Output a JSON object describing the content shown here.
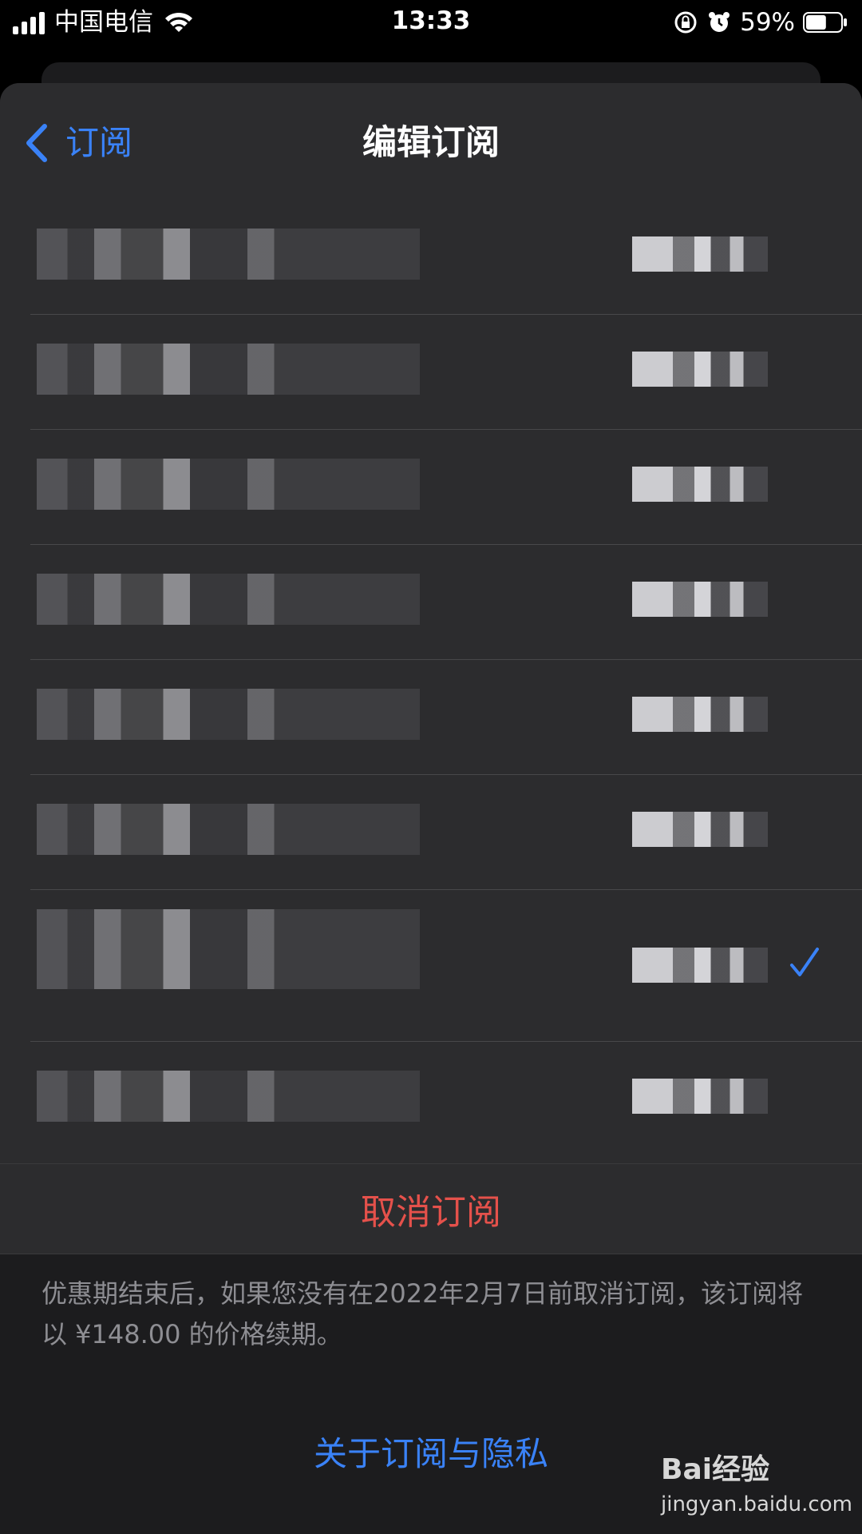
{
  "status_bar": {
    "carrier": "中国电信",
    "time": "13:33",
    "battery_percent": "59%",
    "battery_level": 0.59
  },
  "nav": {
    "back_label": "订阅",
    "title": "编辑订阅"
  },
  "plans": [
    {
      "selected": false
    },
    {
      "selected": false
    },
    {
      "selected": false
    },
    {
      "selected": false
    },
    {
      "selected": false
    },
    {
      "selected": false
    },
    {
      "selected": true
    },
    {
      "selected": false
    }
  ],
  "actions": {
    "cancel_label": "取消订阅",
    "privacy_label": "关于订阅与隐私"
  },
  "footnote": "优惠期结束后，如果您没有在2022年2月7日前取消订阅，该订阅将以 ¥148.00 的价格续期。",
  "watermark": {
    "logo": "Bai经验",
    "url": "jingyan.baidu.com"
  },
  "colors": {
    "accent_blue": "#3a82f7",
    "destructive_red": "#e5514b",
    "sheet_bg": "#1c1c1e",
    "row_bg": "#2c2c2e"
  }
}
